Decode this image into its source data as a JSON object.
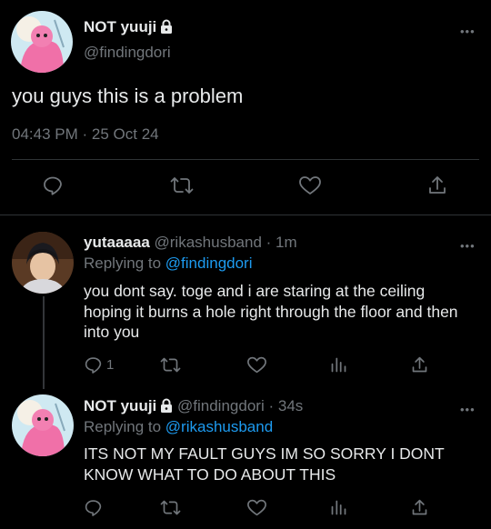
{
  "main_tweet": {
    "display_name": "NOT yuuji",
    "handle": "@findingdori",
    "text": "you guys this is a problem",
    "time": "04:43 PM",
    "separator": "·",
    "date": "25 Oct 24"
  },
  "reply1": {
    "display_name": "yutaaaaa",
    "handle": "@rikashusband",
    "separator": "·",
    "age": "1m",
    "replying_prefix": "Replying to",
    "replying_to": "@findingdori",
    "text": "you dont say. toge and i are staring at the ceiling hoping it burns a hole right through the floor and then into you",
    "reply_count": "1"
  },
  "reply2": {
    "display_name": "NOT yuuji",
    "handle": "@findingdori",
    "separator": "·",
    "age": "34s",
    "replying_prefix": "Replying to",
    "replying_to": "@rikashusband",
    "text": "ITS NOT MY FAULT GUYS IM SO SORRY I DONT KNOW WHAT TO DO ABOUT THIS"
  },
  "more_label": "•••",
  "colors": {
    "background": "#000000",
    "text": "#e7e9ea",
    "muted": "#71767b",
    "link": "#1d9bf0",
    "divider": "#2f3336"
  },
  "icons": [
    "lock-icon",
    "reply-icon",
    "retweet-icon",
    "like-icon",
    "share-icon",
    "analytics-icon",
    "more-icon"
  ]
}
